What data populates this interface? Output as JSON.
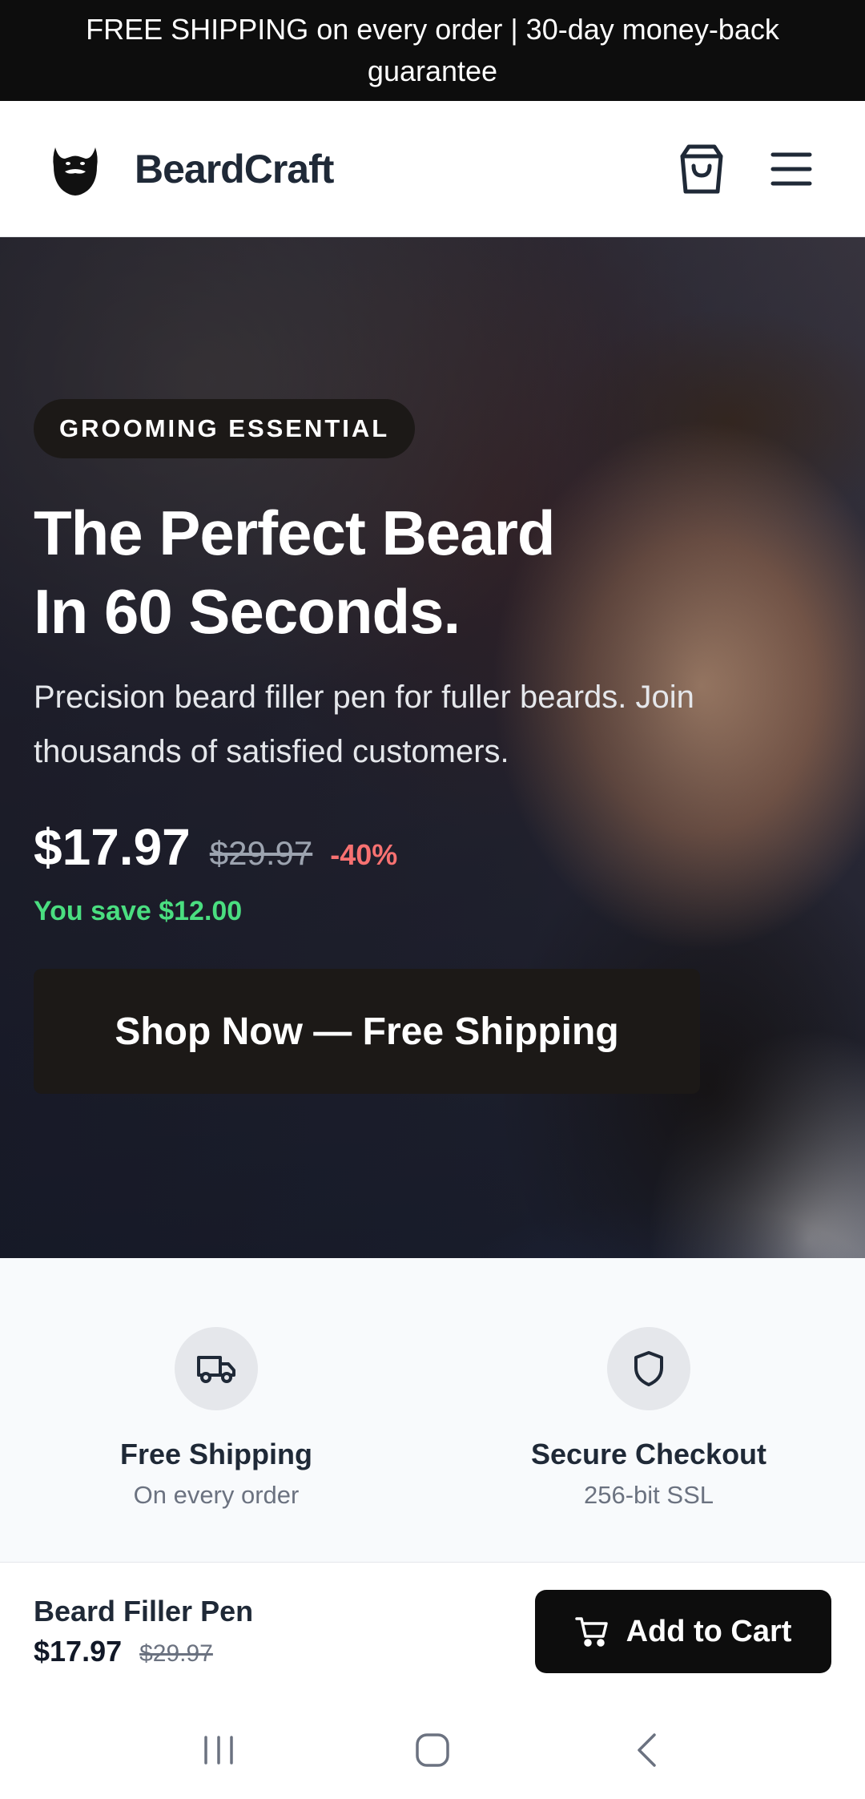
{
  "announcement": {
    "text": "FREE SHIPPING on every order | 30-day money-back guarantee"
  },
  "header": {
    "brand": "BeardCraft",
    "logo_icon": "beard-logo-icon",
    "cart_icon": "shopping-bag-icon",
    "menu_icon": "hamburger-menu-icon"
  },
  "hero": {
    "badge": "GROOMING ESSENTIAL",
    "title_line1": "The Perfect Beard",
    "title_line2": "In 60 Seconds.",
    "subtitle": "Precision beard filler pen for fuller beards. Join thousands of satisfied customers.",
    "price": "$17.97",
    "original_price": "$29.97",
    "discount": "-40%",
    "savings": "You save $12.00",
    "cta": "Shop Now — Free Shipping"
  },
  "trust": [
    {
      "icon": "truck-icon",
      "title": "Free Shipping",
      "subtitle": "On every order"
    },
    {
      "icon": "shield-icon",
      "title": "Secure Checkout",
      "subtitle": "256-bit SSL"
    }
  ],
  "sticky_bar": {
    "product_name": "Beard Filler Pen",
    "price": "$17.97",
    "original_price": "$29.97",
    "button_label": "Add to Cart",
    "button_icon": "cart-icon"
  },
  "system_nav": {
    "recents_icon": "recents-icon",
    "home_icon": "home-icon",
    "back_icon": "back-icon"
  },
  "colors": {
    "dark": "#0d0d0d",
    "discount": "#f87171",
    "savings": "#4ade80",
    "trust_bg": "#f8fafc"
  }
}
